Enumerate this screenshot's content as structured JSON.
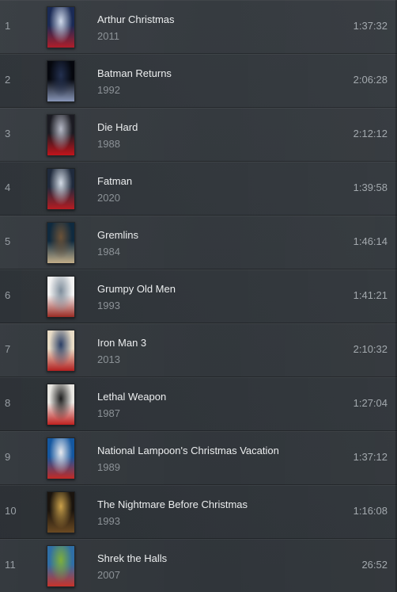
{
  "items": [
    {
      "index": "1",
      "title": "Arthur Christmas",
      "year": "2011",
      "duration": "1:37:32",
      "poster": {
        "icon": "poster-arthur-christmas-icon",
        "colors": [
          "#1a2a55",
          "#cfd9ea",
          "#b01e2a"
        ]
      }
    },
    {
      "index": "2",
      "title": "Batman Returns",
      "year": "1992",
      "duration": "2:06:28",
      "poster": {
        "icon": "poster-batman-returns-icon",
        "colors": [
          "#05070d",
          "#23304f",
          "#8896b8"
        ]
      }
    },
    {
      "index": "3",
      "title": "Die Hard",
      "year": "1988",
      "duration": "2:12:12",
      "poster": {
        "icon": "poster-die-hard-icon",
        "colors": [
          "#1b1b22",
          "#b6b9c6",
          "#c2141b"
        ]
      }
    },
    {
      "index": "4",
      "title": "Fatman",
      "year": "2020",
      "duration": "1:39:58",
      "poster": {
        "icon": "poster-fatman-icon",
        "colors": [
          "#1f2a3c",
          "#d3dbe5",
          "#b61c22"
        ]
      }
    },
    {
      "index": "5",
      "title": "Gremlins",
      "year": "1984",
      "duration": "1:46:14",
      "poster": {
        "icon": "poster-gremlins-icon",
        "colors": [
          "#0f2a3f",
          "#6b5238",
          "#c2ae8a"
        ]
      }
    },
    {
      "index": "6",
      "title": "Grumpy Old Men",
      "year": "1993",
      "duration": "1:41:21",
      "poster": {
        "icon": "poster-grumpy-old-men-icon",
        "colors": [
          "#f2f2f2",
          "#7f8e9c",
          "#9a2b24"
        ]
      }
    },
    {
      "index": "7",
      "title": "Iron Man 3",
      "year": "2013",
      "duration": "2:10:32",
      "poster": {
        "icon": "poster-iron-man-3-icon",
        "colors": [
          "#e8dcc6",
          "#2b3f66",
          "#b21f1f"
        ]
      }
    },
    {
      "index": "8",
      "title": "Lethal Weapon",
      "year": "1987",
      "duration": "1:27:04",
      "poster": {
        "icon": "poster-lethal-weapon-icon",
        "colors": [
          "#e9e7e2",
          "#1e1e1e",
          "#c0201f"
        ]
      }
    },
    {
      "index": "9",
      "title": "National Lampoon's Christmas Vacation",
      "year": "1989",
      "duration": "1:37:12",
      "poster": {
        "icon": "poster-christmas-vacation-icon",
        "colors": [
          "#1457a0",
          "#e7e9ee",
          "#c32a25"
        ]
      }
    },
    {
      "index": "10",
      "title": "The Nightmare Before Christmas",
      "year": "1993",
      "duration": "1:16:08",
      "poster": {
        "icon": "poster-nightmare-before-christmas-icon",
        "colors": [
          "#1a140e",
          "#cba14a",
          "#6b4a22"
        ]
      }
    },
    {
      "index": "11",
      "title": "Shrek the Halls",
      "year": "2007",
      "duration": "26:52",
      "poster": {
        "icon": "poster-shrek-the-halls-icon",
        "colors": [
          "#2f6fa6",
          "#7fae3a",
          "#c9322a"
        ]
      }
    }
  ]
}
